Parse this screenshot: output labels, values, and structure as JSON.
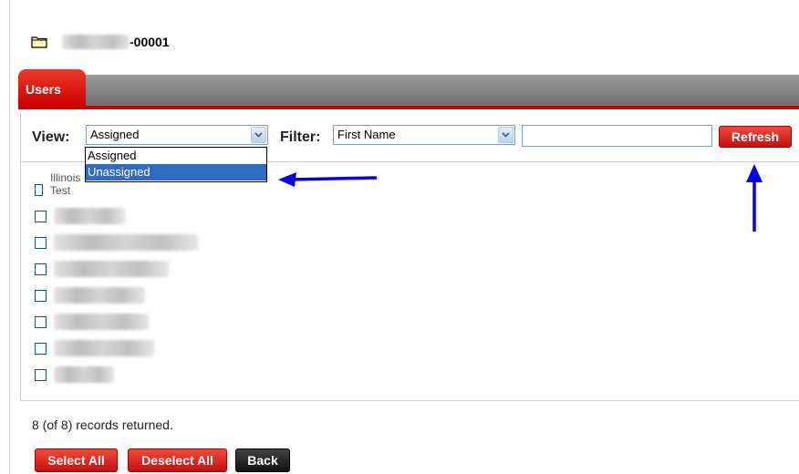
{
  "header": {
    "account_suffix": "-00001",
    "folder_icon": "folder-icon"
  },
  "tabs": [
    {
      "label": "Users",
      "active": true
    }
  ],
  "toolbar": {
    "view_label": "View:",
    "view_value": "Assigned",
    "filter_label": "Filter:",
    "filter_value": "First Name",
    "filter_text": "",
    "refresh_label": "Refresh"
  },
  "view_options": [
    "Assigned",
    "Unassigned"
  ],
  "view_highlighted": "Unassigned",
  "users": [
    {
      "name": "Illinois Test",
      "checked": false
    },
    {
      "name": "",
      "checked": false
    },
    {
      "name": "",
      "checked": false
    },
    {
      "name": "",
      "checked": false
    },
    {
      "name": "",
      "checked": false
    },
    {
      "name": "",
      "checked": false
    },
    {
      "name": "",
      "checked": false
    },
    {
      "name": "",
      "checked": false
    }
  ],
  "records_text": "8 (of 8) records returned.",
  "actions": {
    "select_all": "Select All",
    "deselect_all": "Deselect All",
    "back": "Back"
  },
  "colors": {
    "accent_red": "#cc0000",
    "annotation_blue": "#0000ee",
    "highlight_blue": "#316ac5"
  }
}
